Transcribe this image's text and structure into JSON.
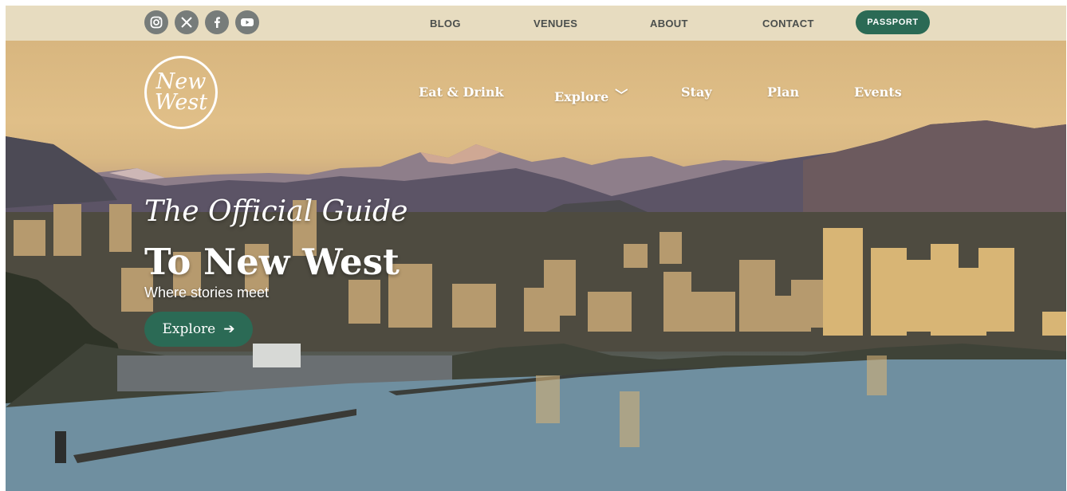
{
  "social": [
    {
      "icon": "instagram-icon",
      "glyph": "◎"
    },
    {
      "icon": "x-icon",
      "glyph": "𝕏"
    },
    {
      "icon": "facebook-icon",
      "glyph": "f"
    },
    {
      "icon": "youtube-icon",
      "glyph": "▶"
    }
  ],
  "util_nav": {
    "blog": "BLOG",
    "venues": "VENUES",
    "about": "ABOUT",
    "contact": "CONTACT",
    "passport": "PASSPORT"
  },
  "logo": {
    "line1": "New",
    "line2": "West"
  },
  "main_nav": {
    "eat_drink": "Eat & Drink",
    "explore": "Explore",
    "stay": "Stay",
    "plan": "Plan",
    "events": "Events"
  },
  "hero": {
    "title_line1": "The Official Guide",
    "title_line2": "To New West",
    "subtitle": "Where stories meet",
    "cta_label": "Explore",
    "cta_arrow": "➔"
  },
  "colors": {
    "utility_bar": "#e7dcc0",
    "brand_green": "#2b6a55",
    "social_icon": "#777c7a"
  }
}
